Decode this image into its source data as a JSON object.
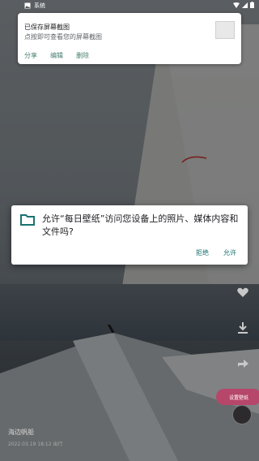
{
  "status_bar": {
    "app_label": "系统"
  },
  "notification": {
    "title": "已保存屏幕截图",
    "subtitle": "点按即可查看您的屏幕截图",
    "actions": [
      "分享",
      "编辑",
      "删除"
    ]
  },
  "permission_dialog": {
    "message": "允许“每日壁纸”访问您设备上的照片、媒体内容和文件吗?",
    "deny_label": "拒绝",
    "allow_label": "允许"
  },
  "wallpaper": {
    "set_button_label": "设置壁纸",
    "caption": "海边帆船",
    "timestamp": "2022.03.19 18:12 出行"
  },
  "colors": {
    "notif_action": "#4a7f73",
    "dialog_action": "#1a7370",
    "fab": "#b7466b"
  }
}
